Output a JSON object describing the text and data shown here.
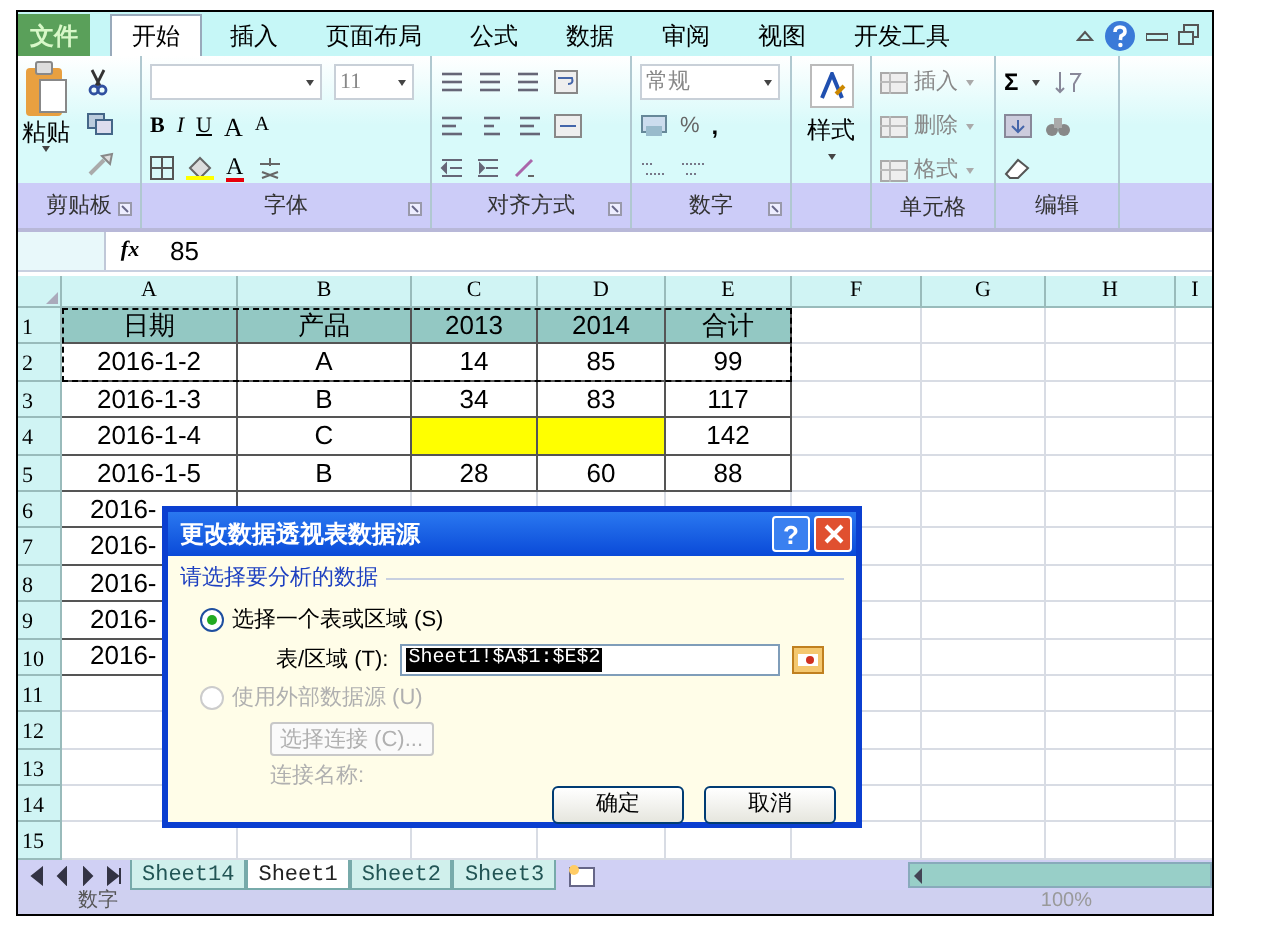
{
  "tabs": [
    {
      "label": "文件",
      "kind": "file",
      "selected": false
    },
    {
      "label": "开始",
      "kind": "tab",
      "selected": true
    },
    {
      "label": "插入",
      "kind": "tab",
      "selected": false
    },
    {
      "label": "页面布局",
      "kind": "tab",
      "selected": false
    },
    {
      "label": "公式",
      "kind": "tab",
      "selected": false
    },
    {
      "label": "数据",
      "kind": "tab",
      "selected": false
    },
    {
      "label": "审阅",
      "kind": "tab",
      "selected": false
    },
    {
      "label": "视图",
      "kind": "tab",
      "selected": false
    },
    {
      "label": "开发工具",
      "kind": "tab",
      "selected": false
    }
  ],
  "ribbon": {
    "groups": [
      {
        "kind": "clipboard",
        "label": "剪贴板",
        "paste": "粘贴"
      },
      {
        "kind": "font",
        "label": "字体",
        "font_size": "11",
        "bold": "B",
        "italic": "I",
        "underline": "U",
        "grow": "A",
        "shrink": "A",
        "font_color": "A"
      },
      {
        "kind": "alignment",
        "label": "对齐方式"
      },
      {
        "kind": "number",
        "label": "数字",
        "format": "常规",
        "percent": "%",
        "comma": ","
      },
      {
        "kind": "styles",
        "button": "样式"
      },
      {
        "kind": "cells",
        "label": "单元格",
        "buttons": [
          "插入",
          "删除",
          "格式"
        ]
      },
      {
        "kind": "editing",
        "label": "编辑",
        "sum": "Σ"
      }
    ]
  },
  "formula_bar": {
    "function_label": "fx",
    "value": "85"
  },
  "sheet": {
    "columns": [
      "A",
      "B",
      "C",
      "D",
      "E",
      "F",
      "G",
      "H",
      "I"
    ],
    "copy_marquee": true,
    "rows": [
      {
        "number": "1",
        "kind": "header",
        "cells": [
          {
            "text": "日期",
            "highlighted": false
          },
          {
            "text": "产品",
            "highlighted": false
          },
          {
            "text": "2013",
            "highlighted": false
          },
          {
            "text": "2014",
            "highlighted": false
          },
          {
            "text": "合计",
            "highlighted": false
          }
        ]
      },
      {
        "number": "2",
        "kind": "data",
        "cells": [
          {
            "text": "2016-1-2",
            "highlighted": false
          },
          {
            "text": "A",
            "highlighted": false
          },
          {
            "text": "14",
            "highlighted": false
          },
          {
            "text": "85",
            "highlighted": false
          },
          {
            "text": "99",
            "highlighted": false
          }
        ]
      },
      {
        "number": "3",
        "kind": "data",
        "cells": [
          {
            "text": "2016-1-3",
            "highlighted": false
          },
          {
            "text": "B",
            "highlighted": false
          },
          {
            "text": "34",
            "highlighted": false
          },
          {
            "text": "83",
            "highlighted": false
          },
          {
            "text": "117",
            "highlighted": false
          }
        ]
      },
      {
        "number": "4",
        "kind": "data",
        "cells": [
          {
            "text": "2016-1-4",
            "highlighted": false
          },
          {
            "text": "C",
            "highlighted": false
          },
          {
            "highlighted": true
          },
          {
            "highlighted": true
          },
          {
            "text": "142",
            "highlighted": false
          }
        ]
      },
      {
        "number": "5",
        "kind": "data",
        "cells": [
          {
            "text": "2016-1-5",
            "highlighted": false
          },
          {
            "text": "B",
            "highlighted": false
          },
          {
            "text": "28",
            "highlighted": false
          },
          {
            "text": "60",
            "highlighted": false
          },
          {
            "text": "88",
            "highlighted": false
          }
        ]
      },
      {
        "number": "6",
        "kind": "partial",
        "cells": [
          {
            "text": "2016-",
            "highlighted": false
          }
        ]
      },
      {
        "number": "7",
        "kind": "partial",
        "cells": [
          {
            "text": "2016-",
            "highlighted": false
          }
        ]
      },
      {
        "number": "8",
        "kind": "partial",
        "cells": [
          {
            "text": "2016-",
            "highlighted": false
          }
        ]
      },
      {
        "number": "9",
        "kind": "partial",
        "cells": [
          {
            "text": "2016-",
            "highlighted": false
          }
        ]
      },
      {
        "number": "10",
        "kind": "partial",
        "cells": [
          {
            "text": "2016-",
            "highlighted": false
          }
        ]
      },
      {
        "number": "11",
        "kind": "empty",
        "cells": []
      },
      {
        "number": "12",
        "kind": "empty",
        "cells": []
      },
      {
        "number": "13",
        "kind": "empty",
        "cells": []
      },
      {
        "number": "14",
        "kind": "empty",
        "cells": []
      },
      {
        "number": "15",
        "kind": "empty",
        "cells": []
      }
    ]
  },
  "sheet_tabs": [
    {
      "label": "Sheet14",
      "selected": false
    },
    {
      "label": "Sheet1",
      "selected": true
    },
    {
      "label": "Sheet2",
      "selected": false
    },
    {
      "label": "Sheet3",
      "selected": false
    }
  ],
  "status_bar": {
    "mode": "数字",
    "zoom": "100%"
  },
  "dialog": {
    "title": "更改数据透视表数据源",
    "help": "?",
    "section": "请选择要分析的数据",
    "options": [
      {
        "label": "选择一个表或区域 (S)",
        "selected": true,
        "disabled": false
      },
      {
        "label": "使用外部数据源 (U)",
        "selected": false,
        "disabled": true
      }
    ],
    "range_label": "表/区域 (T):",
    "range_value": "Sheet1!$A$1:$E$2",
    "connection_button": "选择连接 (C)...",
    "connection_label": "连接名称:",
    "buttons": [
      "确定",
      "取消"
    ]
  }
}
